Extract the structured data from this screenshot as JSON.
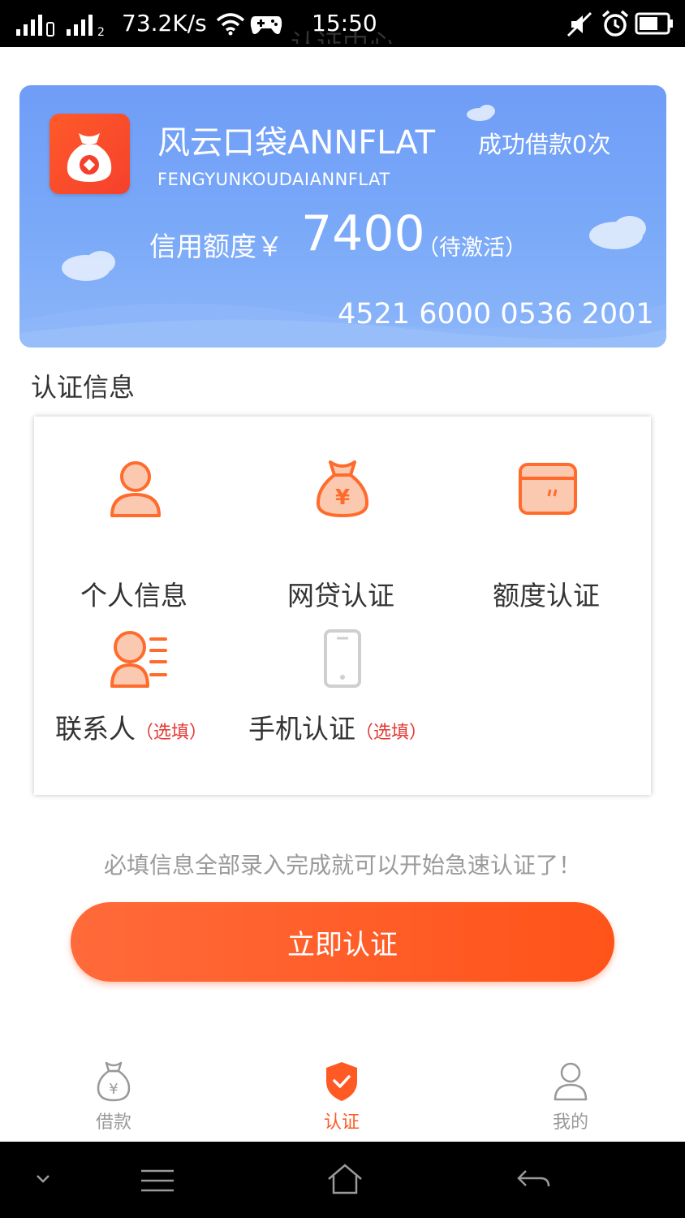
{
  "status_bar": {
    "speed": "73.2K/s",
    "time": "15:50"
  },
  "header": {
    "title": "认证中心"
  },
  "card": {
    "app_name": "风云口袋ANNFLAT",
    "app_subtitle": "FENGYUNKOUDAIANNFLAT",
    "loan_count_text": "成功借款0次",
    "credit_label": "信用额度￥",
    "credit_amount": "7400",
    "credit_status": "（待激活）",
    "card_number": "4521 6000 0536 2001"
  },
  "section_title": "认证信息",
  "auth_items": [
    {
      "label": "个人信息",
      "icon": "person-icon"
    },
    {
      "label": "网贷认证",
      "icon": "money-bag-icon"
    },
    {
      "label": "额度认证",
      "icon": "card-icon"
    },
    {
      "label": "联系人",
      "optional": "（选填）",
      "icon": "contacts-icon"
    },
    {
      "label": "手机认证",
      "optional": "（选填）",
      "icon": "phone-icon"
    }
  ],
  "hint": "必填信息全部录入完成就可以开始急速认证了！",
  "verify_button": "立即认证",
  "bottom_tabs": [
    {
      "label": "借款",
      "icon": "loan-icon",
      "active": false
    },
    {
      "label": "认证",
      "icon": "shield-check-icon",
      "active": true
    },
    {
      "label": "我的",
      "icon": "user-icon",
      "active": false
    }
  ],
  "colors": {
    "accent": "#ff5a24",
    "card_blue": "#77a6f8",
    "inactive": "#999999"
  }
}
